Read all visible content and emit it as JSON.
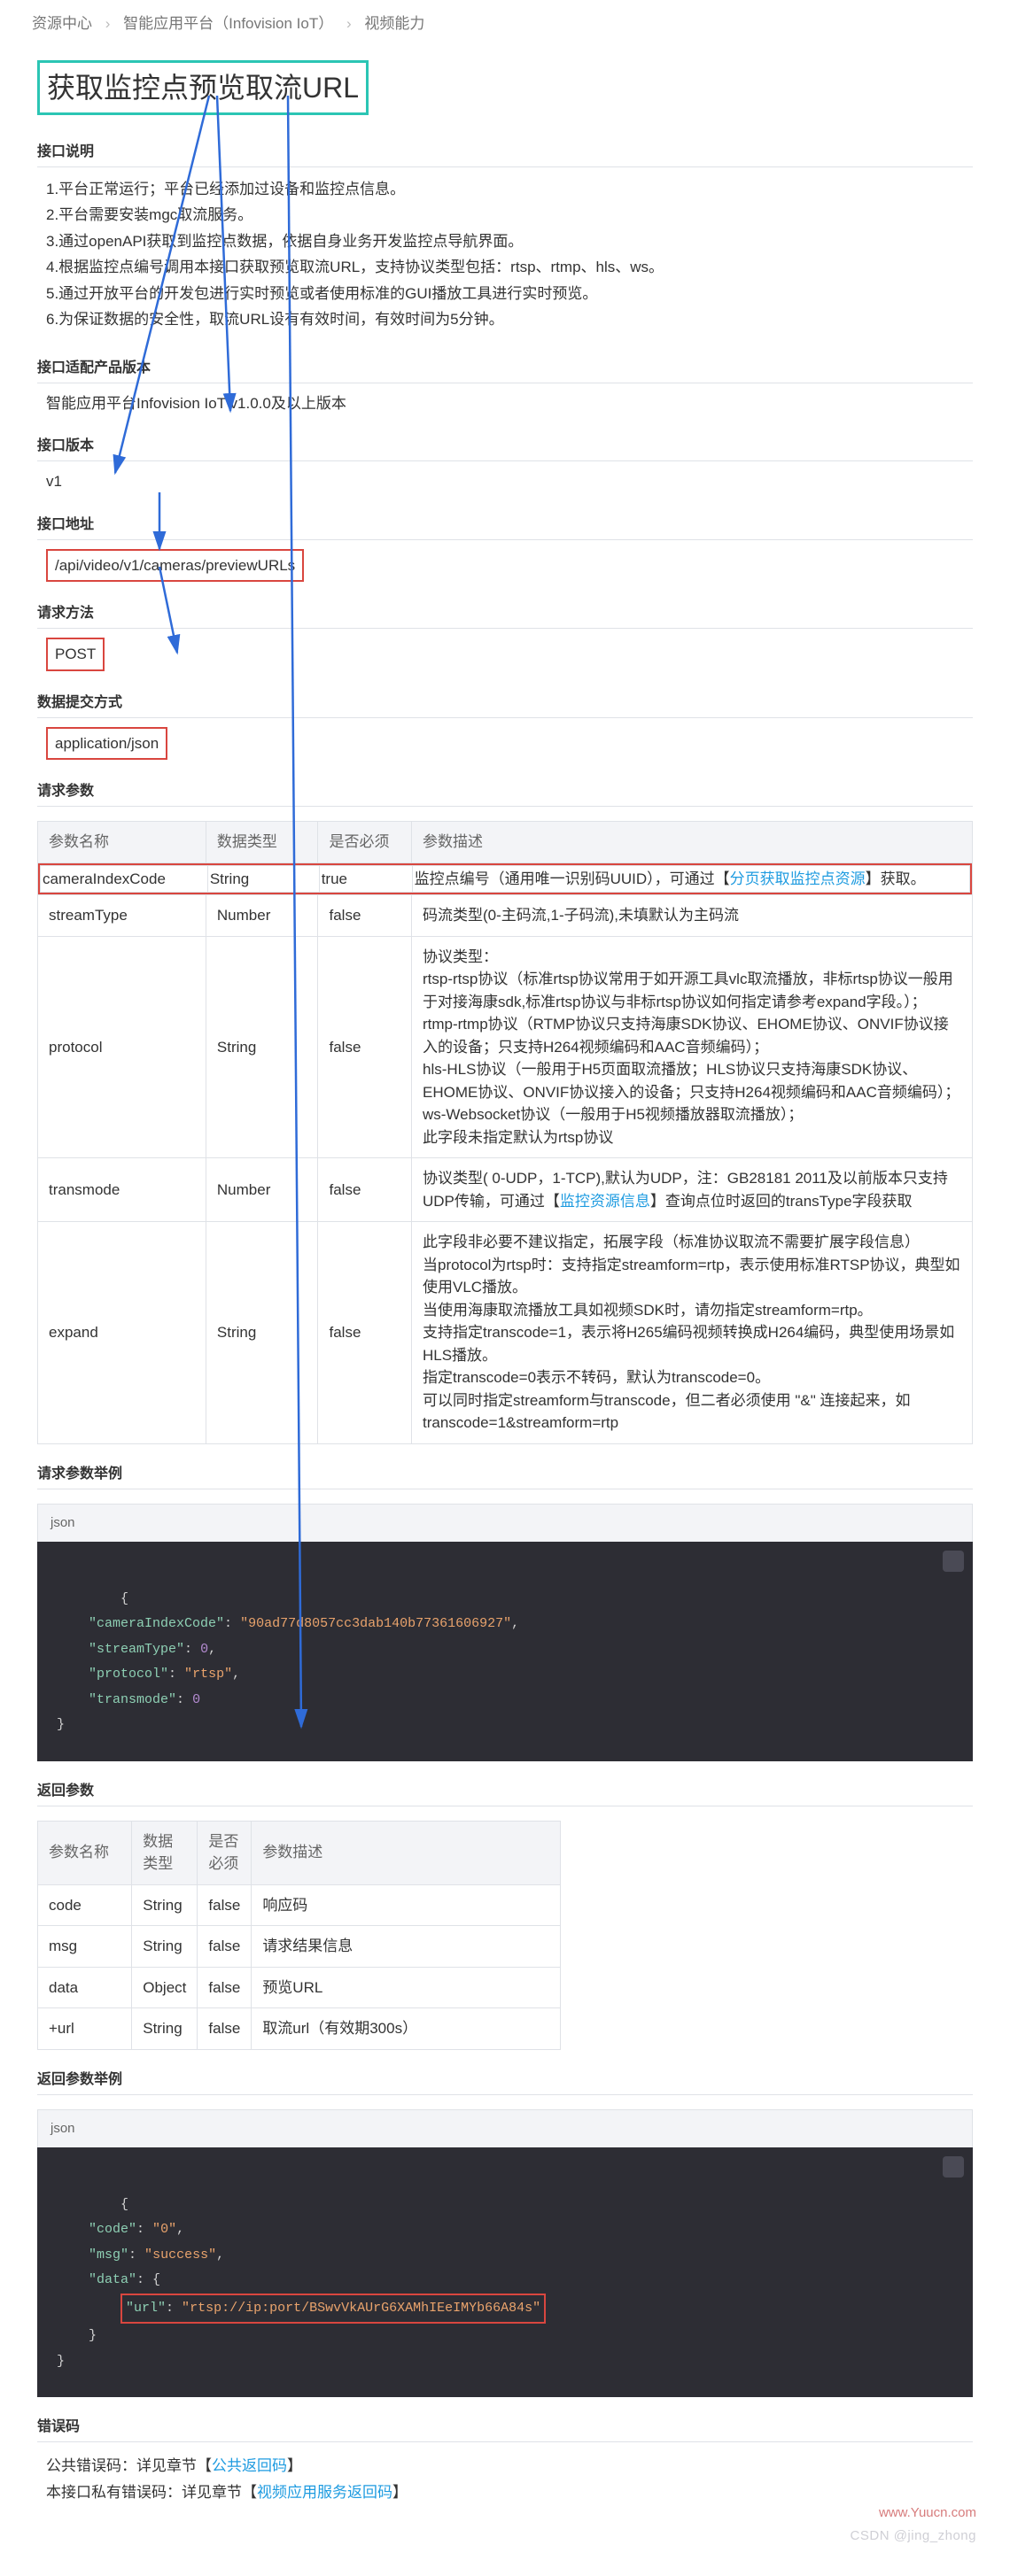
{
  "breadcrumb": [
    "资源中心",
    "智能应用平台（Infovision IoT）",
    "视频能力"
  ],
  "title": "获取监控点预览取流URL",
  "labels": {
    "desc": "接口说明",
    "product": "接口适配产品版本",
    "ver": "接口版本",
    "addr": "接口地址",
    "method": "请求方法",
    "ctype": "数据提交方式",
    "reqParams": "请求参数",
    "reqExample": "请求参数举例",
    "resParams": "返回参数",
    "resExample": "返回参数举例",
    "errCode": "错误码"
  },
  "descLines": [
    "1.平台正常运行；平台已经添加过设备和监控点信息。",
    "2.平台需要安装mgc取流服务。",
    "3.通过openAPI获取到监控点数据，依据自身业务开发监控点导航界面。",
    "4.根据监控点编号调用本接口获取预览取流URL，支持协议类型包括：rtsp、rtmp、hls、ws。",
    "5.通过开放平台的开发包进行实时预览或者使用标准的GUI播放工具进行实时预览。",
    "6.为保证数据的安全性，取流URL设有有效时间，有效时间为5分钟。"
  ],
  "product": "智能应用平台Infovision IoT v1.0.0及以上版本",
  "version": "v1",
  "addr": "/api/video/v1/cameras/previewURLs",
  "method": "POST",
  "ctype": "application/json",
  "reqHead": [
    "参数名称",
    "数据类型",
    "是否必须",
    "参数描述"
  ],
  "reqRows": [
    {
      "name": "cameraIndexCode",
      "type": "String",
      "req": "true",
      "desc": "监控点编号（通用唯一识别码UUID），可通过【",
      "link": "分页获取监控点资源",
      "desc2": "】获取。"
    },
    {
      "name": "streamType",
      "type": "Number",
      "req": "false",
      "desc": "码流类型(0-主码流,1-子码流),未填默认为主码流"
    },
    {
      "name": "protocol",
      "type": "String",
      "req": "false",
      "desc": "协议类型：\nrtsp-rtsp协议（标准rtsp协议常用于如开源工具vlc取流播放，非标rtsp协议一般用于对接海康sdk,标准rtsp协议与非标rtsp协议如何指定请参考expand字段。）；\nrtmp-rtmp协议（RTMP协议只支持海康SDK协议、EHOME协议、ONVIF协议接入的设备；只支持H264视频编码和AAC音频编码）；\nhls-HLS协议（一般用于H5页面取流播放；HLS协议只支持海康SDK协议、EHOME协议、ONVIF协议接入的设备；只支持H264视频编码和AAC音频编码）；\nws-Websocket协议（一般用于H5视频播放器取流播放）；\n此字段未指定默认为rtsp协议"
    },
    {
      "name": "transmode",
      "type": "Number",
      "req": "false",
      "desc": "协议类型( 0-UDP，1-TCP),默认为UDP，注：GB28181 2011及以前版本只支持UDP传输，可通过【",
      "link": "监控资源信息",
      "desc2": "】查询点位时返回的transType字段获取"
    },
    {
      "name": "expand",
      "type": "String",
      "req": "false",
      "desc": "此字段非必要不建议指定，拓展字段（标准协议取流不需要扩展字段信息）\n当protocol为rtsp时：支持指定streamform=rtp，表示使用标准RTSP协议，典型如使用VLC播放。\n当使用海康取流播放工具如视频SDK时，请勿指定streamform=rtp。\n支持指定transcode=1，表示将H265编码视频转换成H264编码，典型使用场景如HLS播放。\n指定transcode=0表示不转码，默认为transcode=0。\n可以同时指定streamform与transcode，但二者必须使用 \"&\" 连接起来，如transcode=1&streamform=rtp"
    }
  ],
  "codeLabel": "json",
  "reqJson": {
    "cameraIndexCode": "90ad77d8057cc3dab140b77361606927",
    "streamType": 0,
    "protocol": "rtsp",
    "transmode": 0
  },
  "resHead": [
    "参数名称",
    "数据类型",
    "是否必须",
    "参数描述"
  ],
  "resRows": [
    {
      "name": "code",
      "type": "String",
      "req": "false",
      "desc": "响应码"
    },
    {
      "name": "msg",
      "type": "String",
      "req": "false",
      "desc": "请求结果信息"
    },
    {
      "name": "data",
      "type": "Object",
      "req": "false",
      "desc": "预览URL"
    },
    {
      "name": "+url",
      "type": "String",
      "req": "false",
      "desc": "取流url（有效期300s）"
    }
  ],
  "resJson": {
    "code": "0",
    "msg": "success",
    "url": "rtsp://ip:port/BSwvVkAUrG6XAMhIEeIMYb66A84s"
  },
  "err": {
    "line1": "公共错误码：详见章节【",
    "link1": "公共返回码",
    "line1b": "】",
    "line2": "本接口私有错误码：详见章节【",
    "link2": "视频应用服务返回码",
    "line2b": "】"
  },
  "watermark": {
    "site": "www.Yuucn.com",
    "author": "CSDN @jing_zhong"
  }
}
